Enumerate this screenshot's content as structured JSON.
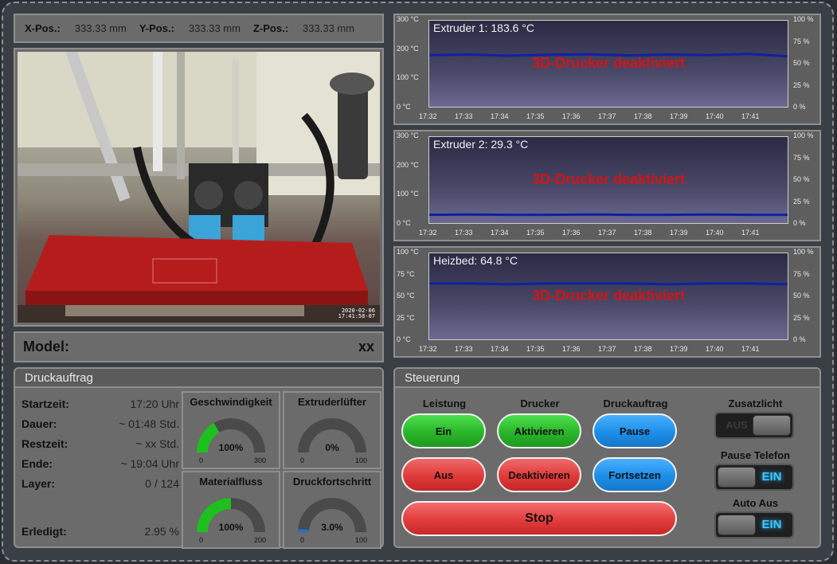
{
  "position": {
    "x_label": "X-Pos.:",
    "x_value": "333.33 mm",
    "y_label": "Y-Pos.:",
    "y_value": "333.33 mm",
    "z_label": "Z-Pos.:",
    "z_value": "333.33 mm"
  },
  "webcam": {
    "date": "2020-02-06",
    "time": "17:41:58-07"
  },
  "model": {
    "label": "Model:",
    "value": "xx"
  },
  "job": {
    "title": "Druckauftrag",
    "stats": [
      {
        "key": "Startzeit:",
        "value": "17:20 Uhr"
      },
      {
        "key": "Dauer:",
        "value": "~ 01:48 Std."
      },
      {
        "key": "Restzeit:",
        "value": "~ xx Std."
      },
      {
        "key": "Ende:",
        "value": "~ 19:04 Uhr"
      },
      {
        "key": "Layer:",
        "value": "0 / 124"
      }
    ],
    "done": {
      "key": "Erledigt:",
      "value": "2.95 %"
    },
    "gauges": [
      {
        "title": "Geschwindigkeit",
        "value_text": "100%",
        "min": "0",
        "max": "300",
        "fraction": 0.333,
        "color": "#1fbf1f"
      },
      {
        "title": "Extruderlüfter",
        "value_text": "0%",
        "min": "0",
        "max": "100",
        "fraction": 0.0,
        "color": "#1fbf1f"
      },
      {
        "title": "Materialfluss",
        "value_text": "100%",
        "min": "0",
        "max": "200",
        "fraction": 0.5,
        "color": "#1fbf1f"
      },
      {
        "title": "Druckfortschritt",
        "value_text": "3.0%",
        "min": "0",
        "max": "100",
        "fraction": 0.03,
        "color": "#1f6fd8"
      }
    ]
  },
  "charts": {
    "deactivated_text": "3D-Drucker deaktiviert",
    "x_ticks": [
      "17:32",
      "17:33",
      "17:34",
      "17:35",
      "17:36",
      "17:37",
      "17:38",
      "17:39",
      "17:40",
      "17:41"
    ],
    "right_ticks": [
      "100 %",
      "75 %",
      "50 %",
      "25 %",
      "0 %"
    ],
    "extruder1": {
      "title": "Extruder 1: 183.6 °C",
      "left_ticks": [
        "300 °C",
        "200 °C",
        "100 °C",
        "0 °C"
      ]
    },
    "extruder2": {
      "title": "Extruder 2: 29.3 °C",
      "left_ticks": [
        "300 °C",
        "200 °C",
        "100 °C",
        "0 °C"
      ]
    },
    "heizbed": {
      "title": "Heizbed: 64.8 °C",
      "left_ticks": [
        "100 °C",
        "75 °C",
        "50 °C",
        "25 °C",
        "0 °C"
      ]
    }
  },
  "chart_data": [
    {
      "type": "line",
      "title": "Extruder 1: 183.6 °C",
      "x": [
        "17:32",
        "17:33",
        "17:34",
        "17:35",
        "17:36",
        "17:37",
        "17:38",
        "17:39",
        "17:40",
        "17:41"
      ],
      "ylim_left": [
        0,
        300
      ],
      "ylim_right": [
        0,
        100
      ],
      "series": [
        {
          "values": [
            180,
            182,
            178,
            181,
            183,
            179,
            182,
            180,
            184,
            176
          ],
          "color": "#1020a0"
        }
      ]
    },
    {
      "type": "line",
      "title": "Extruder 2: 29.3 °C",
      "x": [
        "17:32",
        "17:33",
        "17:34",
        "17:35",
        "17:36",
        "17:37",
        "17:38",
        "17:39",
        "17:40",
        "17:41"
      ],
      "ylim_left": [
        0,
        300
      ],
      "ylim_right": [
        0,
        100
      ],
      "series": [
        {
          "values": [
            29,
            30,
            29,
            29,
            30,
            29,
            29,
            30,
            29,
            29
          ],
          "color": "#1020a0"
        }
      ]
    },
    {
      "type": "line",
      "title": "Heizbed: 64.8 °C",
      "x": [
        "17:32",
        "17:33",
        "17:34",
        "17:35",
        "17:36",
        "17:37",
        "17:38",
        "17:39",
        "17:40",
        "17:41"
      ],
      "ylim_left": [
        0,
        100
      ],
      "ylim_right": [
        0,
        100
      ],
      "series": [
        {
          "values": [
            65,
            65,
            64,
            65,
            65,
            65,
            64,
            65,
            65,
            64
          ],
          "color": "#1020a0"
        }
      ]
    }
  ],
  "control": {
    "title": "Steuerung",
    "col_leistung": "Leistung",
    "col_drucker": "Drucker",
    "col_druckauftrag": "Druckauftrag",
    "btn_ein": "Ein",
    "btn_aus": "Aus",
    "btn_aktivieren": "Aktivieren",
    "btn_deaktivieren": "Deaktivieren",
    "btn_pause": "Pause",
    "btn_fortsetzen": "Fortsetzen",
    "btn_stop": "Stop",
    "zusatzlicht": {
      "label": "Zusatzlicht",
      "state": "AUS"
    },
    "pause_telefon": {
      "label": "Pause Telefon",
      "state": "EIN"
    },
    "auto_aus": {
      "label": "Auto Aus",
      "state": "EIN"
    }
  }
}
